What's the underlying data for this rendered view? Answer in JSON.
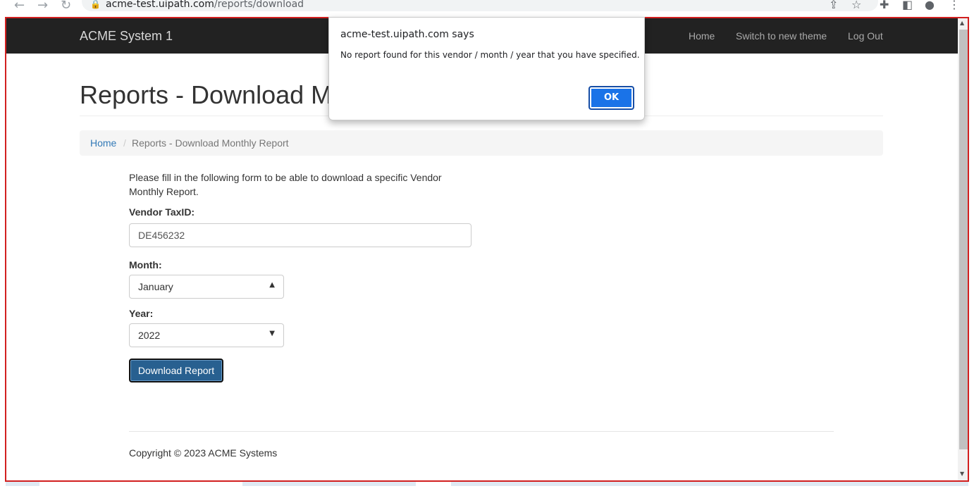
{
  "browser": {
    "url_host": "acme-test.uipath.com",
    "url_path": "/reports/download"
  },
  "navbar": {
    "brand": "ACME System 1",
    "links": [
      "Home",
      "Switch to new theme",
      "Log Out"
    ]
  },
  "page": {
    "title": "Reports - Download M",
    "breadcrumb": {
      "home": "Home",
      "separator": "/",
      "current": "Reports - Download Monthly Report"
    },
    "intro": "Please fill in the following form to be able to download a specific Vendor Monthly Report.",
    "vendor_label": "Vendor TaxID:",
    "vendor_value": "DE456232",
    "month_label": "Month:",
    "month_value": "January",
    "year_label": "Year:",
    "year_value": "2022",
    "download_button": "Download Report",
    "copyright": "Copyright © 2023 ACME Systems"
  },
  "dialog": {
    "title": "acme-test.uipath.com says",
    "message": "No report found for this vendor / month / year that you have specified.",
    "ok_label": "OK"
  },
  "colors": {
    "highlight_frame": "#d21f1f",
    "navbar_bg": "#222222",
    "link_blue": "#337ab7",
    "primary_button": "#286090",
    "dialog_button": "#1a73e8"
  }
}
